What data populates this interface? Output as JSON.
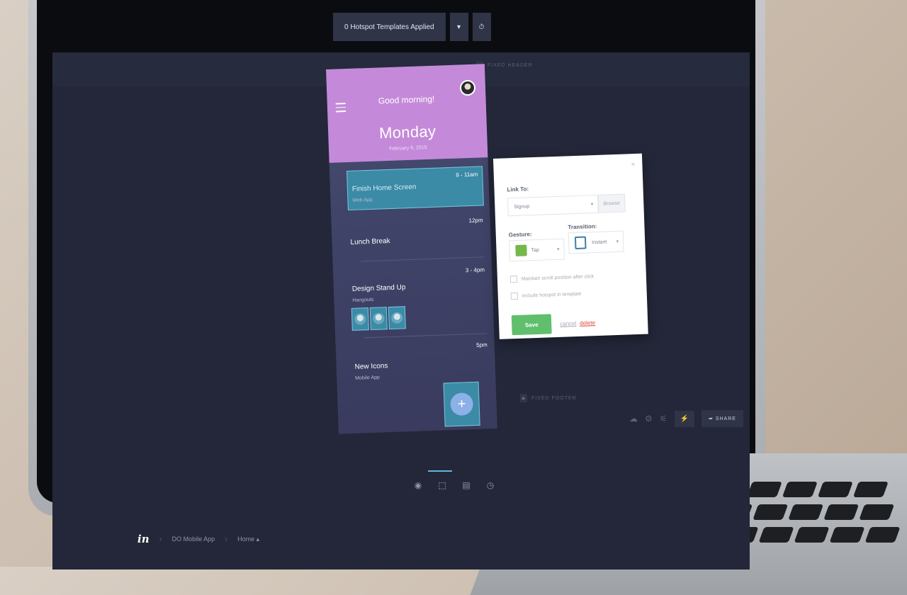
{
  "topbar": {
    "templates_label": "0 Hotspot Templates Applied",
    "dropdown_caret": "▾",
    "timer_icon": "⏱"
  },
  "labels": {
    "fixed_header": "FIXED HEADER",
    "fixed_footer": "FIXED FOOTER",
    "side_icon": "≡"
  },
  "phone": {
    "greeting": "Good morning!",
    "day": "Monday",
    "date": "February 8, 2015",
    "events": [
      {
        "time": "9 - 11am",
        "title": "Finish Home Screen",
        "sub": "Web App"
      },
      {
        "time": "12pm",
        "title": "Lunch Break",
        "sub": ""
      },
      {
        "time": "3 - 4pm",
        "title": "Design Stand Up",
        "sub": "Hangouts"
      },
      {
        "time": "5pm",
        "title": "New Icons",
        "sub": "Mobile App"
      }
    ],
    "fab_icon": "+"
  },
  "popup": {
    "close": "×",
    "link_to_label": "Link To:",
    "link_to_value": "Signup",
    "browse_label": "Browse",
    "gesture_label": "Gesture:",
    "gesture_value": "Tap",
    "transition_label": "Transition:",
    "transition_value": "Instant",
    "caret": "▾",
    "option_scroll": "Maintain scroll position after click",
    "option_template": "Include hotspot in template",
    "save_label": "Save",
    "cancel_label": "cancel",
    "delete_label": "delete",
    "save_color": "#5fbf6c",
    "delete_color": "#e0463a"
  },
  "bottom": {
    "tools": [
      "eye-icon",
      "hotspot-select-icon",
      "comment-icon",
      "history-icon"
    ],
    "tool_glyphs": [
      "◉",
      "⬚",
      "▤",
      "◷"
    ],
    "right_glyphs": {
      "cloud": "☁",
      "gear": "⚙",
      "sliders": "⚟",
      "bolt": "⚡",
      "share_arrow": "➦"
    },
    "share_label": "SHARE"
  },
  "breadcrumb": {
    "logo": "in",
    "project": "DO Mobile App",
    "screen": "Home",
    "screen_caret": "▴",
    "chevron": "›"
  }
}
